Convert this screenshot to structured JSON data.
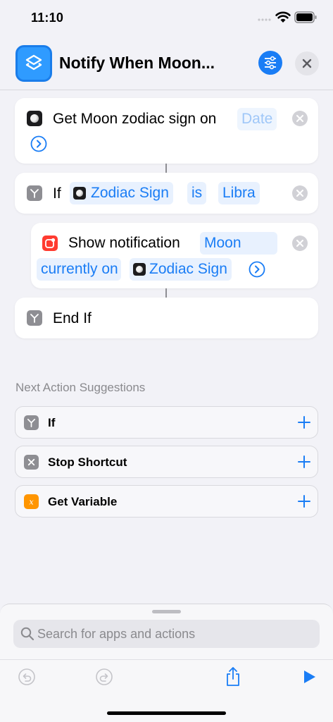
{
  "status_bar": {
    "time": "11:10"
  },
  "header": {
    "title": "Notify When Moon..."
  },
  "actions": {
    "get_moon": {
      "label": "Get Moon zodiac sign on",
      "date_token": "Date"
    },
    "if_block": {
      "keyword": "If",
      "variable": "Zodiac Sign",
      "operator": "is",
      "value": "Libra"
    },
    "notification": {
      "label": "Show notification",
      "text_part1": "Moon",
      "text_part2": "currently on",
      "variable": "Zodiac Sign"
    },
    "end_if": {
      "label": "End If"
    }
  },
  "suggestions": {
    "heading": "Next Action Suggestions",
    "items": [
      {
        "label": "If",
        "icon": "if-icon"
      },
      {
        "label": "Stop Shortcut",
        "icon": "stop-icon"
      },
      {
        "label": "Get Variable",
        "icon": "variable-icon"
      }
    ]
  },
  "search": {
    "placeholder": "Search for apps and actions"
  },
  "colors": {
    "accent": "#1a7df5",
    "background": "#f2f2f7",
    "notification_red": "#ff3b30",
    "variable_orange": "#ff9500"
  }
}
